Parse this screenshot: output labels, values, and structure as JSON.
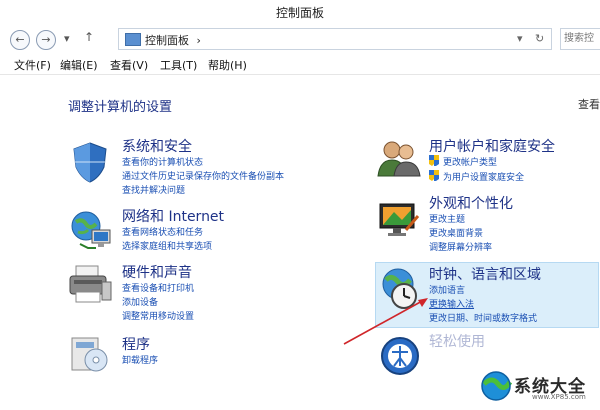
{
  "window": {
    "title": "控制面板"
  },
  "address": {
    "path": "控制面板",
    "separator": "›",
    "search_placeholder": "搜索控"
  },
  "menu": [
    "文件(F)",
    "编辑(E)",
    "查看(V)",
    "工具(T)",
    "帮助(H)"
  ],
  "page": {
    "title": "调整计算机的设置",
    "view_by": "查看"
  },
  "categories": {
    "system_security": {
      "title": "系统和安全",
      "links": [
        "查看你的计算机状态",
        "通过文件历史记录保存你的文件备份副本",
        "查找并解决问题"
      ]
    },
    "network": {
      "title": "网络和 Internet",
      "links": [
        "查看网络状态和任务",
        "选择家庭组和共享选项"
      ]
    },
    "hardware": {
      "title": "硬件和声音",
      "links": [
        "查看设备和打印机",
        "添加设备",
        "调整常用移动设置"
      ]
    },
    "programs": {
      "title": "程序",
      "links": [
        "卸载程序"
      ]
    },
    "user_accounts": {
      "title": "用户帐户和家庭安全",
      "links": [
        "更改帐户类型",
        "为用户设置家庭安全"
      ]
    },
    "appearance": {
      "title": "外观和个性化",
      "links": [
        "更改主题",
        "更改桌面背景",
        "调整屏幕分辨率"
      ]
    },
    "clock_region": {
      "title": "时钟、语言和区域",
      "links": [
        "添加语言",
        "更换输入法",
        "更改日期、时间或数字格式"
      ]
    },
    "ease_of_access": {
      "title": "轻松使用"
    }
  },
  "watermark": {
    "text": "系统大全",
    "url": "www.XP85.com"
  },
  "colors": {
    "link": "#1a4fb3",
    "category": "#1e3287",
    "highlight": "#dbeefa",
    "arrow": "#d0262a"
  }
}
